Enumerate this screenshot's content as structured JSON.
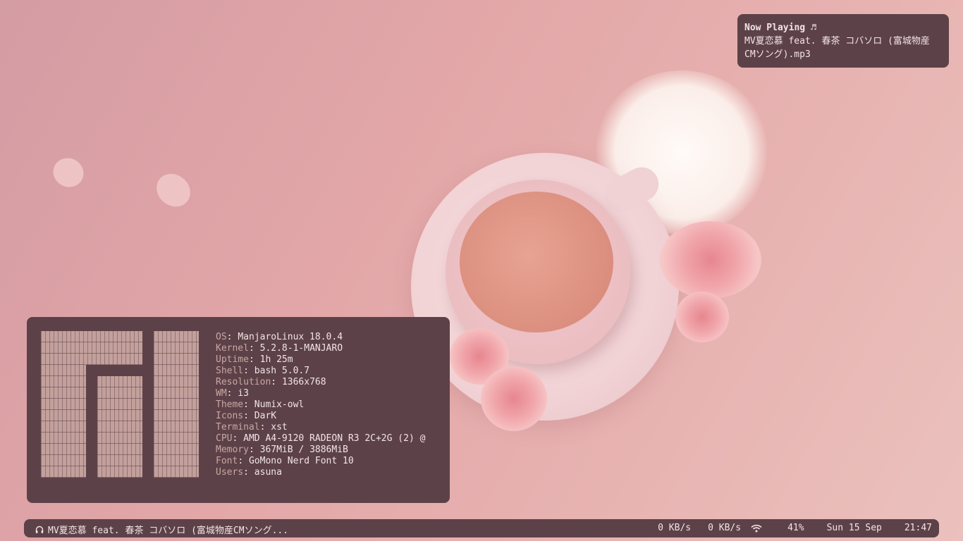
{
  "notification": {
    "title": "Now Playing ♬",
    "body": "MV夏恋慕 feat. 春茶 コバソロ (富城物産\nCMソング).mp3"
  },
  "neofetch": {
    "rows": [
      {
        "k": "OS",
        "v": "ManjaroLinux 18.0.4"
      },
      {
        "k": "Kernel",
        "v": "5.2.8-1-MANJARO"
      },
      {
        "k": "Uptime",
        "v": "1h 25m"
      },
      {
        "k": "Shell",
        "v": "bash 5.0.7"
      },
      {
        "k": "Resolution",
        "v": "1366x768"
      },
      {
        "k": "WM",
        "v": "i3"
      },
      {
        "k": "Theme",
        "v": "Numix-owl"
      },
      {
        "k": "Icons",
        "v": "DarK"
      },
      {
        "k": "Terminal",
        "v": "xst"
      },
      {
        "k": "CPU",
        "v": "AMD A4-9120 RADEON R3 2C+2G (2) @"
      },
      {
        "k": "Memory",
        "v": "367MiB / 3886MiB"
      },
      {
        "k": "Font",
        "v": "GoMono Nerd Font 10"
      },
      {
        "k": "Users",
        "v": "asuna"
      }
    ]
  },
  "bar": {
    "track": "MV夏恋慕 feat. 春茶 コバソロ (富城物産CMソング...",
    "down": "0 KB/s",
    "up": "0 KB/s",
    "battery": "41%",
    "date": "Sun 15 Sep",
    "time": "21:47",
    "icons": [
      "headphones-icon",
      "download-arrow-icon",
      "upload-arrow-icon",
      "wifi-icon",
      "battery-icon",
      "calendar-icon",
      "clock-icon"
    ]
  },
  "colors": {
    "panel": "#5c4248",
    "text": "#f3e4e6",
    "key": "#c9a6a3",
    "logo": "#c3a09c"
  }
}
